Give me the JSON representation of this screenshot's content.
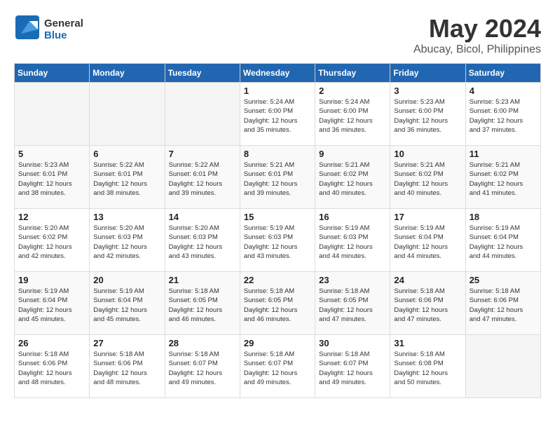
{
  "header": {
    "logo_line1": "General",
    "logo_line2": "Blue",
    "month": "May 2024",
    "location": "Abucay, Bicol, Philippines"
  },
  "weekdays": [
    "Sunday",
    "Monday",
    "Tuesday",
    "Wednesday",
    "Thursday",
    "Friday",
    "Saturday"
  ],
  "weeks": [
    [
      {
        "day": "",
        "info": ""
      },
      {
        "day": "",
        "info": ""
      },
      {
        "day": "",
        "info": ""
      },
      {
        "day": "1",
        "info": "Sunrise: 5:24 AM\nSunset: 6:00 PM\nDaylight: 12 hours\nand 35 minutes."
      },
      {
        "day": "2",
        "info": "Sunrise: 5:24 AM\nSunset: 6:00 PM\nDaylight: 12 hours\nand 36 minutes."
      },
      {
        "day": "3",
        "info": "Sunrise: 5:23 AM\nSunset: 6:00 PM\nDaylight: 12 hours\nand 36 minutes."
      },
      {
        "day": "4",
        "info": "Sunrise: 5:23 AM\nSunset: 6:00 PM\nDaylight: 12 hours\nand 37 minutes."
      }
    ],
    [
      {
        "day": "5",
        "info": "Sunrise: 5:23 AM\nSunset: 6:01 PM\nDaylight: 12 hours\nand 38 minutes."
      },
      {
        "day": "6",
        "info": "Sunrise: 5:22 AM\nSunset: 6:01 PM\nDaylight: 12 hours\nand 38 minutes."
      },
      {
        "day": "7",
        "info": "Sunrise: 5:22 AM\nSunset: 6:01 PM\nDaylight: 12 hours\nand 39 minutes."
      },
      {
        "day": "8",
        "info": "Sunrise: 5:21 AM\nSunset: 6:01 PM\nDaylight: 12 hours\nand 39 minutes."
      },
      {
        "day": "9",
        "info": "Sunrise: 5:21 AM\nSunset: 6:02 PM\nDaylight: 12 hours\nand 40 minutes."
      },
      {
        "day": "10",
        "info": "Sunrise: 5:21 AM\nSunset: 6:02 PM\nDaylight: 12 hours\nand 40 minutes."
      },
      {
        "day": "11",
        "info": "Sunrise: 5:21 AM\nSunset: 6:02 PM\nDaylight: 12 hours\nand 41 minutes."
      }
    ],
    [
      {
        "day": "12",
        "info": "Sunrise: 5:20 AM\nSunset: 6:02 PM\nDaylight: 12 hours\nand 42 minutes."
      },
      {
        "day": "13",
        "info": "Sunrise: 5:20 AM\nSunset: 6:03 PM\nDaylight: 12 hours\nand 42 minutes."
      },
      {
        "day": "14",
        "info": "Sunrise: 5:20 AM\nSunset: 6:03 PM\nDaylight: 12 hours\nand 43 minutes."
      },
      {
        "day": "15",
        "info": "Sunrise: 5:19 AM\nSunset: 6:03 PM\nDaylight: 12 hours\nand 43 minutes."
      },
      {
        "day": "16",
        "info": "Sunrise: 5:19 AM\nSunset: 6:03 PM\nDaylight: 12 hours\nand 44 minutes."
      },
      {
        "day": "17",
        "info": "Sunrise: 5:19 AM\nSunset: 6:04 PM\nDaylight: 12 hours\nand 44 minutes."
      },
      {
        "day": "18",
        "info": "Sunrise: 5:19 AM\nSunset: 6:04 PM\nDaylight: 12 hours\nand 44 minutes."
      }
    ],
    [
      {
        "day": "19",
        "info": "Sunrise: 5:19 AM\nSunset: 6:04 PM\nDaylight: 12 hours\nand 45 minutes."
      },
      {
        "day": "20",
        "info": "Sunrise: 5:19 AM\nSunset: 6:04 PM\nDaylight: 12 hours\nand 45 minutes."
      },
      {
        "day": "21",
        "info": "Sunrise: 5:18 AM\nSunset: 6:05 PM\nDaylight: 12 hours\nand 46 minutes."
      },
      {
        "day": "22",
        "info": "Sunrise: 5:18 AM\nSunset: 6:05 PM\nDaylight: 12 hours\nand 46 minutes."
      },
      {
        "day": "23",
        "info": "Sunrise: 5:18 AM\nSunset: 6:05 PM\nDaylight: 12 hours\nand 47 minutes."
      },
      {
        "day": "24",
        "info": "Sunrise: 5:18 AM\nSunset: 6:06 PM\nDaylight: 12 hours\nand 47 minutes."
      },
      {
        "day": "25",
        "info": "Sunrise: 5:18 AM\nSunset: 6:06 PM\nDaylight: 12 hours\nand 47 minutes."
      }
    ],
    [
      {
        "day": "26",
        "info": "Sunrise: 5:18 AM\nSunset: 6:06 PM\nDaylight: 12 hours\nand 48 minutes."
      },
      {
        "day": "27",
        "info": "Sunrise: 5:18 AM\nSunset: 6:06 PM\nDaylight: 12 hours\nand 48 minutes."
      },
      {
        "day": "28",
        "info": "Sunrise: 5:18 AM\nSunset: 6:07 PM\nDaylight: 12 hours\nand 49 minutes."
      },
      {
        "day": "29",
        "info": "Sunrise: 5:18 AM\nSunset: 6:07 PM\nDaylight: 12 hours\nand 49 minutes."
      },
      {
        "day": "30",
        "info": "Sunrise: 5:18 AM\nSunset: 6:07 PM\nDaylight: 12 hours\nand 49 minutes."
      },
      {
        "day": "31",
        "info": "Sunrise: 5:18 AM\nSunset: 6:08 PM\nDaylight: 12 hours\nand 50 minutes."
      },
      {
        "day": "",
        "info": ""
      }
    ]
  ]
}
